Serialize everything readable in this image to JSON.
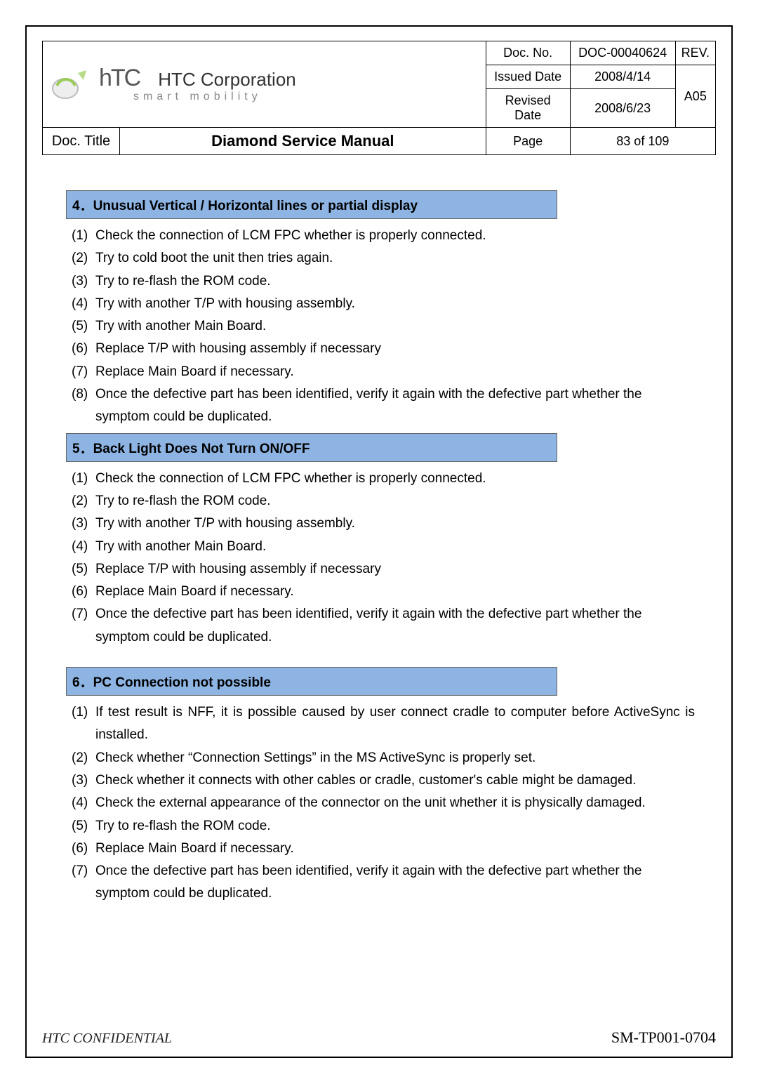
{
  "header": {
    "company": "HTC Corporation",
    "tagline": "smart mobility",
    "doc_no_label": "Doc. No.",
    "doc_no": "DOC-00040624",
    "rev_label": "REV.",
    "rev": "A05",
    "issued_label": "Issued Date",
    "issued": "2008/4/14",
    "revised_label": "Revised Date",
    "revised": "2008/6/23",
    "doc_title_label": "Doc. Title",
    "doc_title": "Diamond Service Manual",
    "page_label": "Page",
    "page": "83  of  109"
  },
  "sections": [
    {
      "title": "4．Unusual Vertical / Horizontal lines or partial display",
      "items": [
        "Check the connection of LCM FPC whether is properly connected.",
        "Try to cold boot the unit then tries again.",
        "Try to re-flash the ROM code.",
        "Try with another T/P with housing assembly.",
        "Try with another Main Board.",
        "Replace T/P with housing assembly if necessary",
        "Replace Main Board if necessary.",
        "Once the defective part has been identified, verify it again with the defective part whether the symptom could be duplicated."
      ]
    },
    {
      "title": "5．Back Light Does Not Turn ON/OFF",
      "items": [
        "Check the connection of LCM FPC whether is properly connected.",
        "Try to re-flash the ROM code.",
        "Try with another T/P with housing assembly.",
        "Try with another Main Board.",
        "Replace T/P with housing assembly if necessary",
        "Replace Main Board if necessary.",
        "Once the defective part has been identified, verify it again with the defective part whether the symptom could be duplicated."
      ]
    },
    {
      "title": "6．PC Connection not possible",
      "items": [
        "If test result is NFF, it is possible caused by user connect cradle to computer before ActiveSync is installed.",
        "Check whether “Connection Settings” in the MS ActiveSync is properly set.",
        "Check whether it connects with other cables or cradle, customer's cable might be damaged.",
        "Check the external appearance of the connector on the unit whether it is physically damaged.",
        "Try to re-flash the ROM code.",
        "Replace Main Board if necessary.",
        "Once the defective part has been identified, verify it again with the defective part whether the symptom could be duplicated."
      ]
    }
  ],
  "footer": {
    "confidential": "HTC CONFIDENTIAL",
    "doc_code": "SM-TP001-0704"
  }
}
